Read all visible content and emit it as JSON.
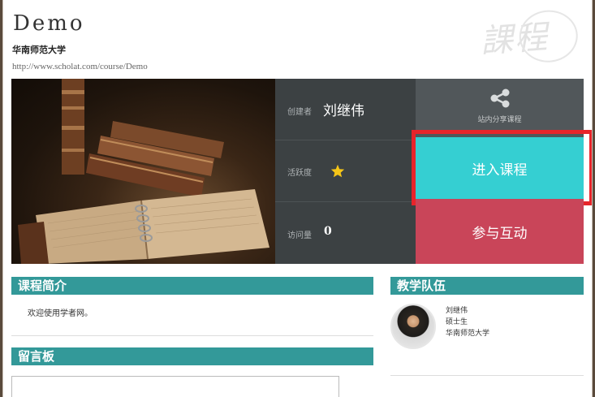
{
  "header": {
    "title": "Demo",
    "school": "华南师范大学",
    "url": "http://www.scholat.com/course/Demo",
    "watermark": "課程"
  },
  "stats": {
    "creator_label": "创建者",
    "creator_name": "刘继伟",
    "activity_label": "活跃度",
    "activity_stars": 1,
    "visits_label": "访问量",
    "visits_value": "0"
  },
  "actions": {
    "share_label": "站内分享课程",
    "enter_label": "进入课程",
    "interact_label": "参与互动"
  },
  "intro": {
    "heading": "课程简介",
    "text": "欢迎使用学者网。"
  },
  "team": {
    "heading": "教学队伍",
    "members": [
      {
        "name": "刘继伟",
        "degree": "硕士生",
        "school": "华南师范大学"
      }
    ]
  },
  "board": {
    "heading": "留言板"
  },
  "colors": {
    "teal_header": "#339999",
    "enter_tile": "#35cfd2",
    "interact_tile": "#c94559",
    "highlight_outline": "#e8242a",
    "star": "#f5c518"
  }
}
